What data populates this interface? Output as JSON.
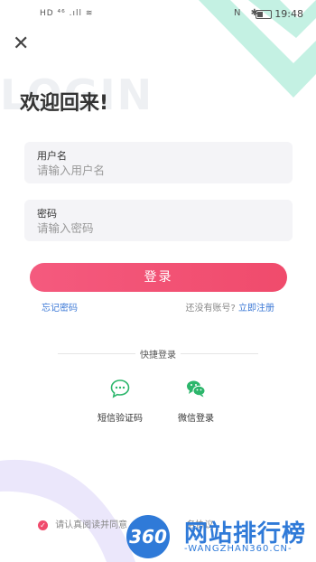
{
  "status_bar": {
    "left_indicators": "HD ⁴⁶ .ıll ≋",
    "right_icons": "N ✱",
    "time": "19:48"
  },
  "background": {
    "watermark_word": "LOGIN",
    "accent_mint": "#bff0e0",
    "accent_purple": "#ece8fa"
  },
  "header": {
    "close_glyph": "✕",
    "welcome": "欢迎回来!"
  },
  "form": {
    "username": {
      "label": "用户名",
      "placeholder": "请输入用户名"
    },
    "password": {
      "label": "密码",
      "placeholder": "请输入密码"
    },
    "login_button": "登录",
    "forgot_password": "忘记密码",
    "no_account": "还没有账号?",
    "register_now": "立即注册"
  },
  "quick_login": {
    "title": "快捷登录",
    "methods": [
      {
        "label": "短信验证码",
        "icon": "sms-icon",
        "color": "#2cb66b"
      },
      {
        "label": "微信登录",
        "icon": "wechat-icon",
        "color": "#2cb66b"
      }
    ]
  },
  "agreement": {
    "text": "请认真阅读并同意",
    "tail": "务协议",
    "check_glyph": "✓"
  },
  "overlay_watermark": {
    "logo_text": "360",
    "cn_text": "网站排行榜",
    "en_text": "-WANGZHAN360.CN-"
  }
}
